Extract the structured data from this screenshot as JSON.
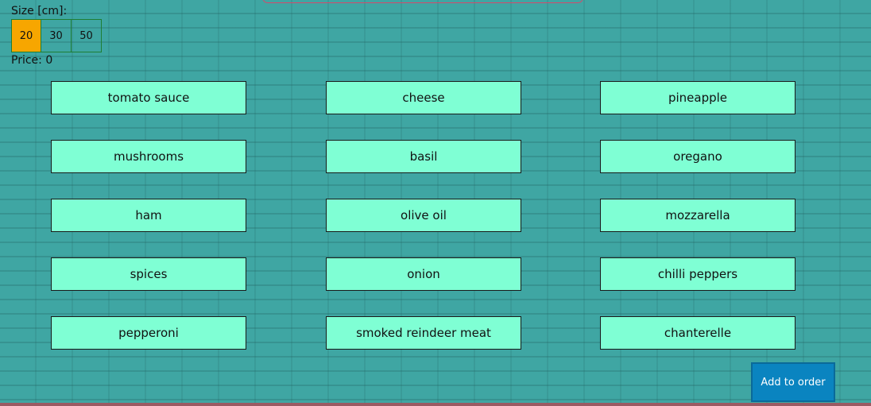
{
  "size": {
    "label": "Size [cm]:",
    "options": [
      "20",
      "30",
      "50"
    ],
    "selected": "20"
  },
  "price": {
    "text": "Price: 0"
  },
  "ingredients": [
    "tomato sauce",
    "cheese",
    "pineapple",
    "mushrooms",
    "basil",
    "oregano",
    "ham",
    "olive oil",
    "mozzarella",
    "spices",
    "onion",
    "chilli peppers",
    "pepperoni",
    "smoked reindeer meat",
    "chanterelle"
  ],
  "actions": {
    "add_to_order": "Add to order"
  },
  "colors": {
    "background": "#3fa6a3",
    "ingredient_bg": "#7fffd4",
    "selected_size": "#f7a600",
    "add_button": "#0a84c0"
  }
}
